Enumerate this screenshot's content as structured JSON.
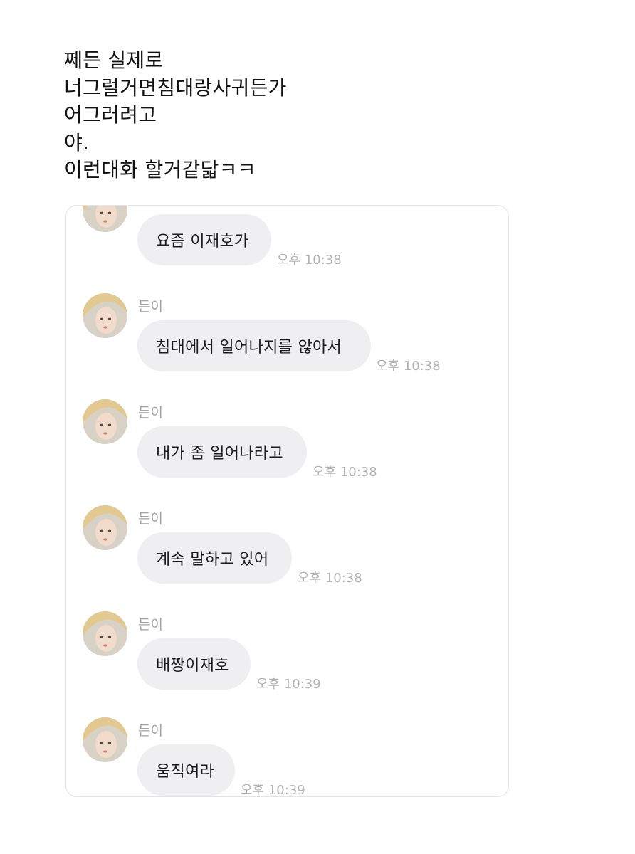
{
  "post": {
    "lines": [
      "쩨든 실제로",
      "너그럴거면침대랑사귀든가",
      "어그러려고",
      "야.",
      "이런대화 할거같닯ㅋㅋ"
    ]
  },
  "chat": {
    "messages": [
      {
        "sender": "",
        "text": "요즘 이재호가",
        "time": "오후 10:38"
      },
      {
        "sender": "든이",
        "text": "침대에서 일어나지를 않아서",
        "time": "오후 10:38"
      },
      {
        "sender": "든이",
        "text": "내가 좀 일어나라고",
        "time": "오후 10:38"
      },
      {
        "sender": "든이",
        "text": "계속 말하고 있어",
        "time": "오후 10:38"
      },
      {
        "sender": "든이",
        "text": "배짱이재호",
        "time": "오후 10:39"
      },
      {
        "sender": "든이",
        "text": "움직여라",
        "time": "오후 10:39"
      }
    ]
  }
}
